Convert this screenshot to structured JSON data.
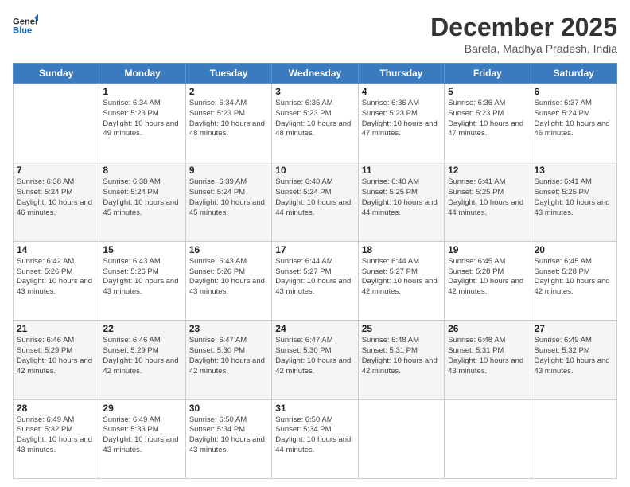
{
  "logo": {
    "line1": "General",
    "line2": "Blue"
  },
  "title": "December 2025",
  "subtitle": "Barela, Madhya Pradesh, India",
  "days_of_week": [
    "Sunday",
    "Monday",
    "Tuesday",
    "Wednesday",
    "Thursday",
    "Friday",
    "Saturday"
  ],
  "weeks": [
    [
      {
        "day": "",
        "sunrise": "",
        "sunset": "",
        "daylight": ""
      },
      {
        "day": "1",
        "sunrise": "Sunrise: 6:34 AM",
        "sunset": "Sunset: 5:23 PM",
        "daylight": "Daylight: 10 hours and 49 minutes."
      },
      {
        "day": "2",
        "sunrise": "Sunrise: 6:34 AM",
        "sunset": "Sunset: 5:23 PM",
        "daylight": "Daylight: 10 hours and 48 minutes."
      },
      {
        "day": "3",
        "sunrise": "Sunrise: 6:35 AM",
        "sunset": "Sunset: 5:23 PM",
        "daylight": "Daylight: 10 hours and 48 minutes."
      },
      {
        "day": "4",
        "sunrise": "Sunrise: 6:36 AM",
        "sunset": "Sunset: 5:23 PM",
        "daylight": "Daylight: 10 hours and 47 minutes."
      },
      {
        "day": "5",
        "sunrise": "Sunrise: 6:36 AM",
        "sunset": "Sunset: 5:23 PM",
        "daylight": "Daylight: 10 hours and 47 minutes."
      },
      {
        "day": "6",
        "sunrise": "Sunrise: 6:37 AM",
        "sunset": "Sunset: 5:24 PM",
        "daylight": "Daylight: 10 hours and 46 minutes."
      }
    ],
    [
      {
        "day": "7",
        "sunrise": "Sunrise: 6:38 AM",
        "sunset": "Sunset: 5:24 PM",
        "daylight": "Daylight: 10 hours and 46 minutes."
      },
      {
        "day": "8",
        "sunrise": "Sunrise: 6:38 AM",
        "sunset": "Sunset: 5:24 PM",
        "daylight": "Daylight: 10 hours and 45 minutes."
      },
      {
        "day": "9",
        "sunrise": "Sunrise: 6:39 AM",
        "sunset": "Sunset: 5:24 PM",
        "daylight": "Daylight: 10 hours and 45 minutes."
      },
      {
        "day": "10",
        "sunrise": "Sunrise: 6:40 AM",
        "sunset": "Sunset: 5:24 PM",
        "daylight": "Daylight: 10 hours and 44 minutes."
      },
      {
        "day": "11",
        "sunrise": "Sunrise: 6:40 AM",
        "sunset": "Sunset: 5:25 PM",
        "daylight": "Daylight: 10 hours and 44 minutes."
      },
      {
        "day": "12",
        "sunrise": "Sunrise: 6:41 AM",
        "sunset": "Sunset: 5:25 PM",
        "daylight": "Daylight: 10 hours and 44 minutes."
      },
      {
        "day": "13",
        "sunrise": "Sunrise: 6:41 AM",
        "sunset": "Sunset: 5:25 PM",
        "daylight": "Daylight: 10 hours and 43 minutes."
      }
    ],
    [
      {
        "day": "14",
        "sunrise": "Sunrise: 6:42 AM",
        "sunset": "Sunset: 5:26 PM",
        "daylight": "Daylight: 10 hours and 43 minutes."
      },
      {
        "day": "15",
        "sunrise": "Sunrise: 6:43 AM",
        "sunset": "Sunset: 5:26 PM",
        "daylight": "Daylight: 10 hours and 43 minutes."
      },
      {
        "day": "16",
        "sunrise": "Sunrise: 6:43 AM",
        "sunset": "Sunset: 5:26 PM",
        "daylight": "Daylight: 10 hours and 43 minutes."
      },
      {
        "day": "17",
        "sunrise": "Sunrise: 6:44 AM",
        "sunset": "Sunset: 5:27 PM",
        "daylight": "Daylight: 10 hours and 43 minutes."
      },
      {
        "day": "18",
        "sunrise": "Sunrise: 6:44 AM",
        "sunset": "Sunset: 5:27 PM",
        "daylight": "Daylight: 10 hours and 42 minutes."
      },
      {
        "day": "19",
        "sunrise": "Sunrise: 6:45 AM",
        "sunset": "Sunset: 5:28 PM",
        "daylight": "Daylight: 10 hours and 42 minutes."
      },
      {
        "day": "20",
        "sunrise": "Sunrise: 6:45 AM",
        "sunset": "Sunset: 5:28 PM",
        "daylight": "Daylight: 10 hours and 42 minutes."
      }
    ],
    [
      {
        "day": "21",
        "sunrise": "Sunrise: 6:46 AM",
        "sunset": "Sunset: 5:29 PM",
        "daylight": "Daylight: 10 hours and 42 minutes."
      },
      {
        "day": "22",
        "sunrise": "Sunrise: 6:46 AM",
        "sunset": "Sunset: 5:29 PM",
        "daylight": "Daylight: 10 hours and 42 minutes."
      },
      {
        "day": "23",
        "sunrise": "Sunrise: 6:47 AM",
        "sunset": "Sunset: 5:30 PM",
        "daylight": "Daylight: 10 hours and 42 minutes."
      },
      {
        "day": "24",
        "sunrise": "Sunrise: 6:47 AM",
        "sunset": "Sunset: 5:30 PM",
        "daylight": "Daylight: 10 hours and 42 minutes."
      },
      {
        "day": "25",
        "sunrise": "Sunrise: 6:48 AM",
        "sunset": "Sunset: 5:31 PM",
        "daylight": "Daylight: 10 hours and 42 minutes."
      },
      {
        "day": "26",
        "sunrise": "Sunrise: 6:48 AM",
        "sunset": "Sunset: 5:31 PM",
        "daylight": "Daylight: 10 hours and 43 minutes."
      },
      {
        "day": "27",
        "sunrise": "Sunrise: 6:49 AM",
        "sunset": "Sunset: 5:32 PM",
        "daylight": "Daylight: 10 hours and 43 minutes."
      }
    ],
    [
      {
        "day": "28",
        "sunrise": "Sunrise: 6:49 AM",
        "sunset": "Sunset: 5:32 PM",
        "daylight": "Daylight: 10 hours and 43 minutes."
      },
      {
        "day": "29",
        "sunrise": "Sunrise: 6:49 AM",
        "sunset": "Sunset: 5:33 PM",
        "daylight": "Daylight: 10 hours and 43 minutes."
      },
      {
        "day": "30",
        "sunrise": "Sunrise: 6:50 AM",
        "sunset": "Sunset: 5:34 PM",
        "daylight": "Daylight: 10 hours and 43 minutes."
      },
      {
        "day": "31",
        "sunrise": "Sunrise: 6:50 AM",
        "sunset": "Sunset: 5:34 PM",
        "daylight": "Daylight: 10 hours and 44 minutes."
      },
      {
        "day": "",
        "sunrise": "",
        "sunset": "",
        "daylight": ""
      },
      {
        "day": "",
        "sunrise": "",
        "sunset": "",
        "daylight": ""
      },
      {
        "day": "",
        "sunrise": "",
        "sunset": "",
        "daylight": ""
      }
    ]
  ]
}
